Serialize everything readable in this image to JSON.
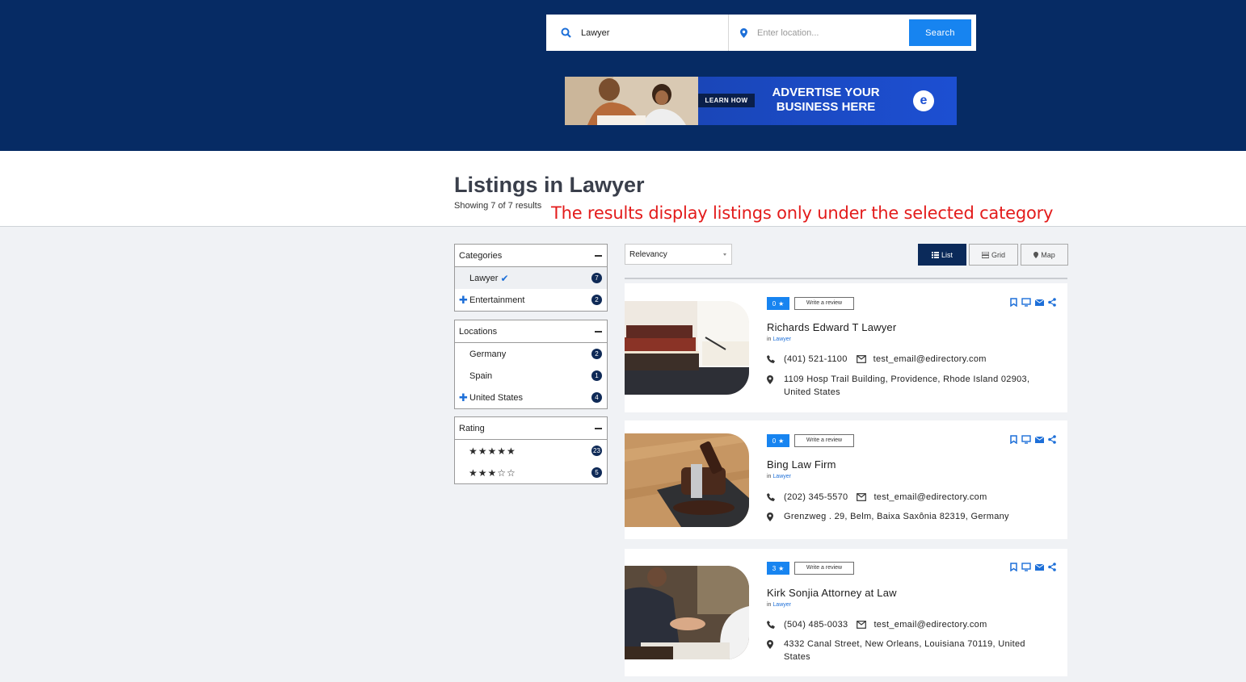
{
  "search": {
    "keyword_value": "Lawyer",
    "location_placeholder": "Enter location...",
    "button_label": "Search"
  },
  "ad": {
    "cta": "LEARN HOW",
    "line1": "ADVERTISE YOUR",
    "line2": "BUSINESS HERE",
    "logo": "e"
  },
  "page": {
    "title": "Listings in Lawyer",
    "results": "Showing 7 of 7 results",
    "annotation": "The results display listings only under the selected category"
  },
  "filters": {
    "categories": {
      "title": "Categories",
      "items": [
        {
          "label": "Lawyer",
          "count": "7"
        },
        {
          "label": "Entertainment",
          "count": "2"
        }
      ]
    },
    "locations": {
      "title": "Locations",
      "items": [
        {
          "label": "Germany",
          "count": "2"
        },
        {
          "label": "Spain",
          "count": "1"
        },
        {
          "label": "United States",
          "count": "4"
        }
      ]
    },
    "rating": {
      "title": "Rating",
      "items": [
        {
          "stars": "★★★★★",
          "count": "23"
        },
        {
          "stars": "★★★☆☆",
          "count": "5"
        }
      ]
    }
  },
  "toolbar": {
    "sort_value": "Relevancy",
    "views": [
      "List",
      "Grid",
      "Map"
    ]
  },
  "listings": [
    {
      "rating": "0",
      "review_label": "Write a review",
      "title": "Richards Edward T Lawyer",
      "in": "in",
      "category": "Lawyer",
      "phone": "(401) 521-1100",
      "email": "test_email@edirectory.com",
      "address": "1109 Hosp Trail Building, Providence, Rhode Island 02903, United States"
    },
    {
      "rating": "0",
      "review_label": "Write a review",
      "title": "Bing Law Firm",
      "in": "in",
      "category": "Lawyer",
      "phone": "(202) 345-5570",
      "email": "test_email@edirectory.com",
      "address": "Grenzweg . 29, Belm, Baixa Saxônia 82319, Germany"
    },
    {
      "rating": "3",
      "review_label": "Write a review",
      "title": "Kirk Sonjia Attorney at Law",
      "in": "in",
      "category": "Lawyer",
      "phone": "(504) 485-0033",
      "email": "test_email@edirectory.com",
      "address": "4332 Canal Street, New Orleans, Louisiana 70119, United States"
    }
  ],
  "colors": {
    "header_bg": "#062b64",
    "accent": "#1784f0",
    "badge": "#0f2a57",
    "annotation": "#e31b1b"
  }
}
